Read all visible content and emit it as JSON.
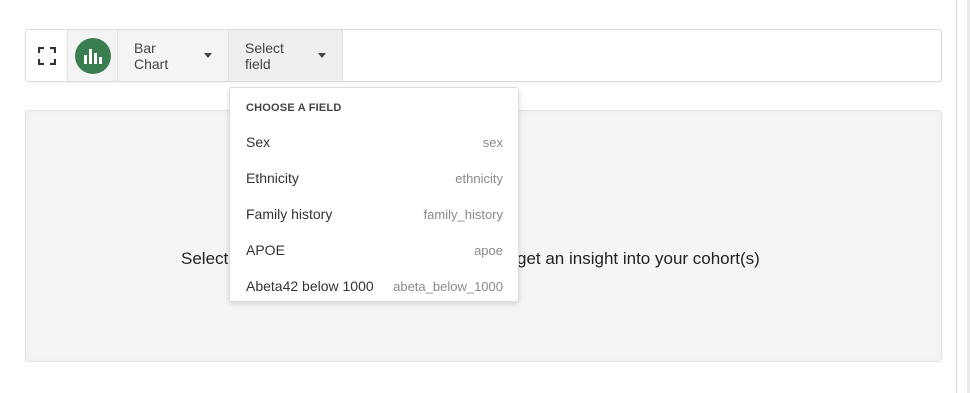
{
  "toolbar": {
    "expand_icon": "expand-icon",
    "chart_icon": "bar-chart-icon",
    "chart_type_label": "Bar Chart",
    "field_select_label": "Select field",
    "accent_color": "#3a7d4f"
  },
  "panel": {
    "message_left": "Select",
    "message_right": "get an insight into your cohort(s)"
  },
  "dropdown": {
    "header": "CHOOSE A FIELD",
    "items": [
      {
        "label": "Sex",
        "key": "sex"
      },
      {
        "label": "Ethnicity",
        "key": "ethnicity"
      },
      {
        "label": "Family history",
        "key": "family_history"
      },
      {
        "label": "APOE",
        "key": "apoe"
      },
      {
        "label": "Abeta42 below 1000",
        "key": "abeta_below_1000"
      }
    ]
  }
}
